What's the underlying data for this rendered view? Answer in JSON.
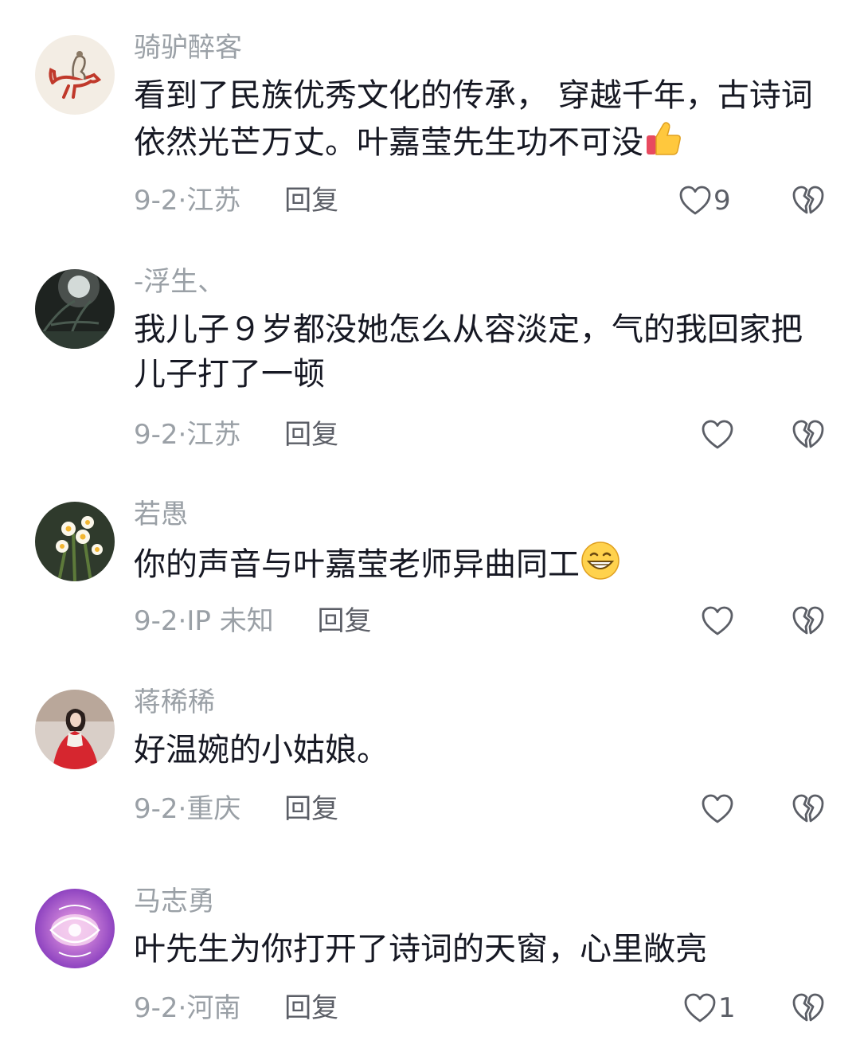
{
  "comments": [
    {
      "username": "骑驴醉客",
      "text": "看到了民族优秀文化的传承， 穿越千年，古诗词依然光芒万丈。叶嘉莹先生功不可没",
      "emoji": "thumbs-up-emoji",
      "date": "9-2",
      "location": "江苏",
      "reply_label": "回复",
      "likes": "9"
    },
    {
      "username": "-浮生、",
      "text": "我儿子９岁都没她怎么从容淡定，气的我回家把儿子打了一顿",
      "date": "9-2",
      "location": "江苏",
      "reply_label": "回复",
      "likes": ""
    },
    {
      "username": "若愚",
      "text": "你的声音与叶嘉莹老师异曲同工",
      "emoji": "grinning-emoji",
      "date": "9-2",
      "location": "IP 未知",
      "reply_label": "回复",
      "likes": ""
    },
    {
      "username": "蒋稀稀",
      "text": "好温婉的小姑娘。",
      "date": "9-2",
      "location": "重庆",
      "reply_label": "回复",
      "likes": ""
    },
    {
      "username": "马志勇",
      "text": "叶先生为你打开了诗词的天窗，心里敞亮",
      "date": "9-2",
      "location": "河南",
      "reply_label": "回复",
      "likes": "1"
    }
  ],
  "icons": {
    "like": "heart-outline-icon",
    "dislike": "broken-heart-icon"
  },
  "colors": {
    "text": "#161823",
    "muted": "#9aa0a6",
    "icon": "#5b5e66"
  }
}
